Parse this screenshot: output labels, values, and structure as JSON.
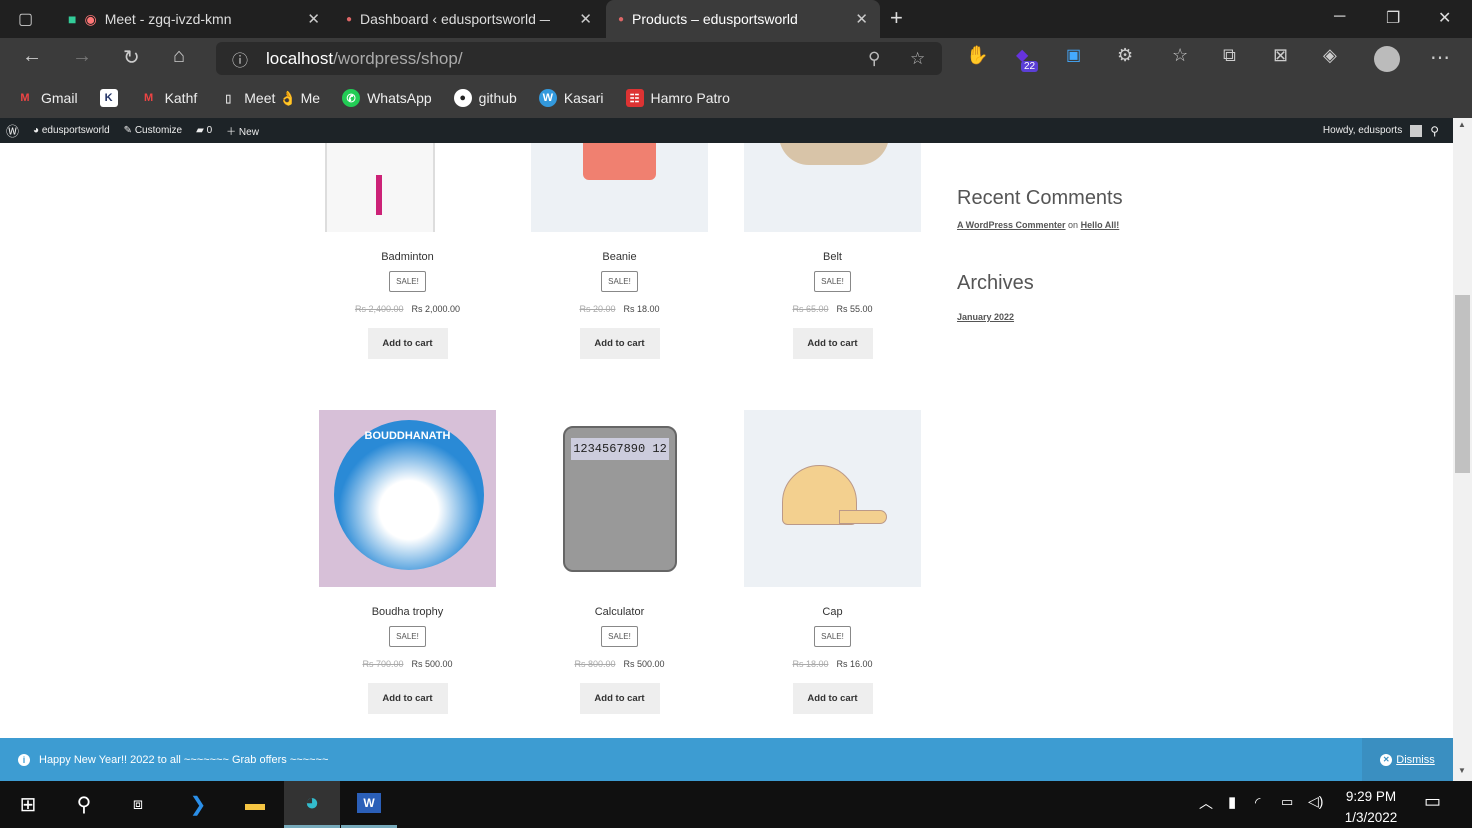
{
  "browser": {
    "tabs": [
      {
        "label": "Meet - zgq-ivzd-kmn",
        "active": false
      },
      {
        "label": "Dashboard ‹ edusportsworld — \\",
        "active": false
      },
      {
        "label": "Products – edusportsworld",
        "active": true
      }
    ],
    "url_host": "localhost",
    "url_path": "/wordpress/shop/",
    "extension_badge": "22",
    "bookmarks": [
      {
        "label": "Gmail",
        "icon": "gmail-icon"
      },
      {
        "label": "",
        "icon": "k-icon"
      },
      {
        "label": "Kathf",
        "icon": "gmail-icon"
      },
      {
        "label": "Meet 👌 Me",
        "icon": "page-icon"
      },
      {
        "label": "WhatsApp",
        "icon": "whatsapp-icon"
      },
      {
        "label": "github",
        "icon": "github-icon"
      },
      {
        "label": "Kasari",
        "icon": "wordpress-icon"
      },
      {
        "label": "Hamro Patro",
        "icon": "hamro-patro-icon"
      }
    ]
  },
  "adminbar": {
    "site": "edusportsworld",
    "customize": "Customize",
    "comments": "0",
    "new": "New",
    "howdy": "Howdy, edusports"
  },
  "products": [
    {
      "name": "Badminton",
      "badge": "SALE!",
      "old_price": "Rs 2,400.00",
      "price": "Rs 2,000.00",
      "button": "Add to cart"
    },
    {
      "name": "Beanie",
      "badge": "SALE!",
      "old_price": "Rs 20.00",
      "price": "Rs 18.00",
      "button": "Add to cart"
    },
    {
      "name": "Belt",
      "badge": "SALE!",
      "old_price": "Rs 65.00",
      "price": "Rs 55.00",
      "button": "Add to cart"
    },
    {
      "name": "Boudha trophy",
      "badge": "SALE!",
      "old_price": "Rs 700.00",
      "price": "Rs 500.00",
      "button": "Add to cart",
      "image_text": "BOUDDHANATH"
    },
    {
      "name": "Calculator",
      "badge": "SALE!",
      "old_price": "Rs 800.00",
      "price": "Rs 500.00",
      "button": "Add to cart",
      "image_text": "1234567890 12"
    },
    {
      "name": "Cap",
      "badge": "SALE!",
      "old_price": "Rs 18.00",
      "price": "Rs 16.00",
      "button": "Add to cart"
    }
  ],
  "sidebar": {
    "recent_comments_title": "Recent Comments",
    "comment_author": "A WordPress Commenter",
    "comment_on": "on",
    "comment_post": "Hello All!",
    "archives_title": "Archives",
    "archive_item": "January 2022"
  },
  "notice": {
    "text": "Happy New Year!! 2022 to all ~~~~~~~ Grab offers ~~~~~~",
    "dismiss": "Dismiss"
  },
  "taskbar": {
    "time": "9:29 PM",
    "date": "1/3/2022"
  },
  "colors": {
    "notice": "#3d9cd2",
    "adminbar": "#1d2327",
    "tabbar": "#202020"
  }
}
